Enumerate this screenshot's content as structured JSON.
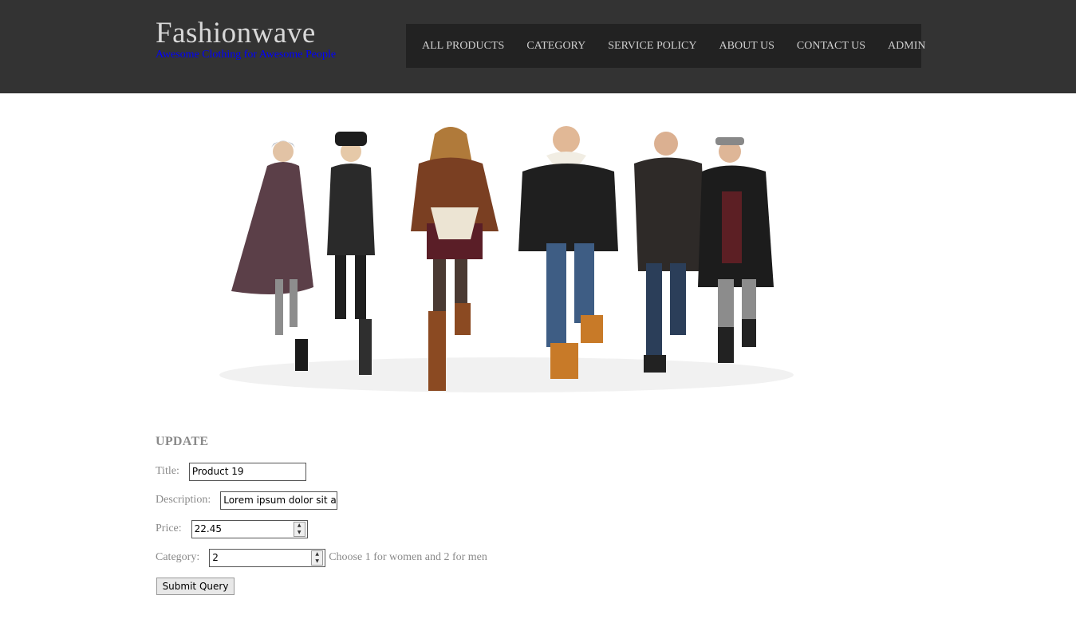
{
  "header": {
    "brand_title": "Fashionwave",
    "brand_tagline": "Awesome Clothing for Awesome People",
    "nav": [
      "ALL PRODUCTS",
      "CATEGORY",
      "SERVICE POLICY",
      "ABOUT US",
      "CONTACT US",
      "ADMIN"
    ]
  },
  "hero": {
    "image": "group-of-models-in-winter-clothing"
  },
  "form": {
    "heading": "UPDATE",
    "title_label": "Title:",
    "title_value": "Product 19",
    "description_label": "Description:",
    "description_value": "Lorem ipsum dolor sit an",
    "price_label": "Price:",
    "price_value": "22.45",
    "category_label": "Category:",
    "category_value": "2",
    "category_hint": "Choose 1 for women and 2 for men",
    "submit_label": "Submit Query"
  },
  "colors": {
    "header_bg": "#333333",
    "nav_bg": "#222222",
    "tagline": "#0000ff"
  }
}
